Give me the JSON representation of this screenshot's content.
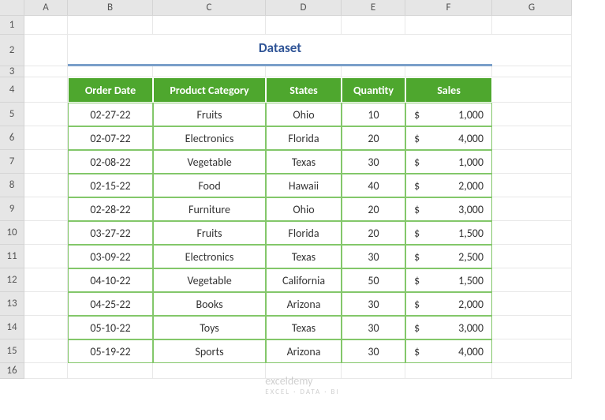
{
  "title": "Dataset",
  "col_headers": [
    "A",
    "B",
    "C",
    "D",
    "E",
    "F",
    "G"
  ],
  "row_headers": [
    "1",
    "2",
    "3",
    "4",
    "5",
    "6",
    "7",
    "8",
    "9",
    "10",
    "11",
    "12",
    "13",
    "14",
    "15",
    "16"
  ],
  "table": {
    "headers": [
      "Order Date",
      "Product Category",
      "States",
      "Quantity",
      "Sales"
    ],
    "rows": [
      {
        "date": "02-27-22",
        "category": "Fruits",
        "state": "Ohio",
        "qty": "10",
        "currency": "$",
        "sales": "1,000"
      },
      {
        "date": "02-07-22",
        "category": "Electronics",
        "state": "Florida",
        "qty": "20",
        "currency": "$",
        "sales": "4,000"
      },
      {
        "date": "02-08-22",
        "category": "Vegetable",
        "state": "Texas",
        "qty": "30",
        "currency": "$",
        "sales": "1,000"
      },
      {
        "date": "02-15-22",
        "category": "Food",
        "state": "Hawaii",
        "qty": "40",
        "currency": "$",
        "sales": "2,000"
      },
      {
        "date": "02-28-22",
        "category": "Furniture",
        "state": "Ohio",
        "qty": "20",
        "currency": "$",
        "sales": "3,000"
      },
      {
        "date": "03-27-22",
        "category": "Fruits",
        "state": "Florida",
        "qty": "20",
        "currency": "$",
        "sales": "1,500"
      },
      {
        "date": "03-09-22",
        "category": "Electronics",
        "state": "Texas",
        "qty": "30",
        "currency": "$",
        "sales": "2,500"
      },
      {
        "date": "04-10-22",
        "category": "Vegetable",
        "state": "California",
        "qty": "50",
        "currency": "$",
        "sales": "1,500"
      },
      {
        "date": "04-25-22",
        "category": "Books",
        "state": "Arizona",
        "qty": "30",
        "currency": "$",
        "sales": "2,000"
      },
      {
        "date": "05-10-22",
        "category": "Toys",
        "state": "Texas",
        "qty": "30",
        "currency": "$",
        "sales": "3,000"
      },
      {
        "date": "05-19-22",
        "category": "Sports",
        "state": "Arizona",
        "qty": "30",
        "currency": "$",
        "sales": "4,000"
      }
    ]
  },
  "watermark": {
    "main": "exceldemy",
    "sub": "EXCEL · DATA · BI"
  }
}
